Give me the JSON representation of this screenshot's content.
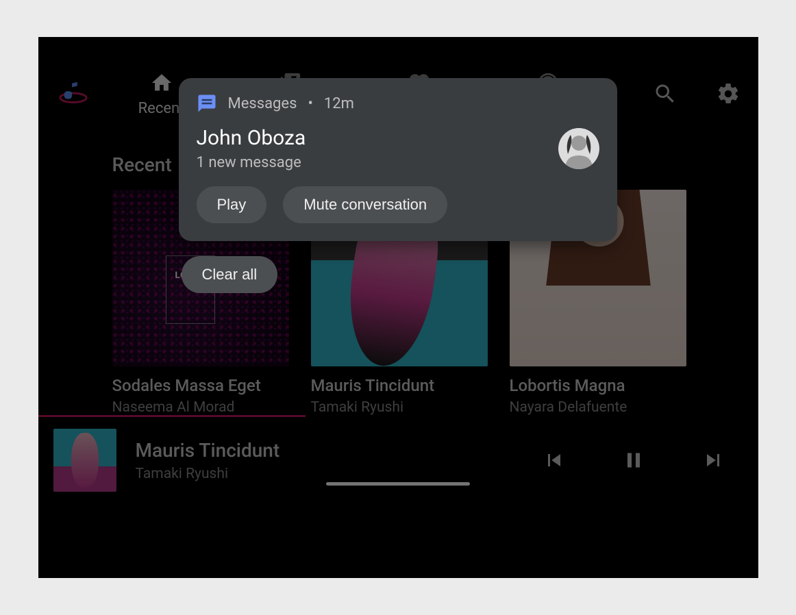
{
  "nav": {
    "tabs": [
      {
        "label": "Recent",
        "icon": "home-icon",
        "active": true
      },
      {
        "label": "",
        "icon": "library-music-icon",
        "active": false
      },
      {
        "label": "",
        "icon": "heart-icon",
        "active": false
      },
      {
        "label": "",
        "icon": "radio-icon",
        "active": false
      }
    ]
  },
  "section": {
    "title": "Recent",
    "cards": [
      {
        "title": "Sodales Massa Eget",
        "subtitle": "Naseema Al Morad",
        "art_text": "LOREM"
      },
      {
        "title": "Mauris Tincidunt",
        "subtitle": "Tamaki Ryushi"
      },
      {
        "title": "Lobortis Magna",
        "subtitle": "Nayara Delafuente"
      }
    ]
  },
  "player": {
    "title": "Mauris Tincidunt",
    "subtitle": "Tamaki Ryushi"
  },
  "notification": {
    "app": "Messages",
    "time": "12m",
    "separator": " • ",
    "sender": "John Oboza",
    "summary": "1 new message",
    "actions": {
      "play": "Play",
      "mute": "Mute conversation"
    }
  },
  "clear_all": "Clear all"
}
